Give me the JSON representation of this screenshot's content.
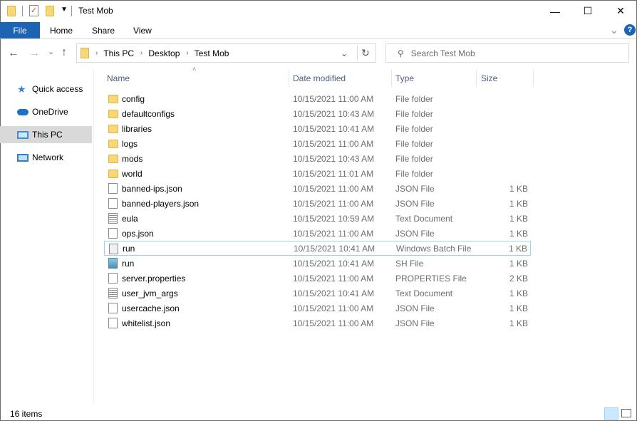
{
  "window": {
    "title": "Test Mob",
    "min": "—",
    "max": "☐",
    "close": "✕"
  },
  "ribbon": {
    "tabs": [
      "File",
      "Home",
      "Share",
      "View"
    ],
    "help": "?",
    "expand": "⌄"
  },
  "nav": {
    "back": "←",
    "forward": "→",
    "recent": "⌄",
    "up": "↑",
    "breadcrumb": [
      "This PC",
      "Desktop",
      "Test Mob"
    ],
    "dropdown": "⌄",
    "refresh": "↻",
    "search_placeholder": "Search Test Mob"
  },
  "sidebar": {
    "items": [
      {
        "label": "Quick access",
        "icon": "star-icon"
      },
      {
        "label": "OneDrive",
        "icon": "cloud-icon"
      },
      {
        "label": "This PC",
        "icon": "computer-icon",
        "selected": true
      },
      {
        "label": "Network",
        "icon": "network-icon"
      }
    ]
  },
  "columns": {
    "name": "Name",
    "date": "Date modified",
    "type": "Type",
    "size": "Size"
  },
  "files": [
    {
      "name": "config",
      "date": "10/15/2021 11:00 AM",
      "type": "File folder",
      "size": "",
      "icon": "folder"
    },
    {
      "name": "defaultconfigs",
      "date": "10/15/2021 10:43 AM",
      "type": "File folder",
      "size": "",
      "icon": "folder"
    },
    {
      "name": "libraries",
      "date": "10/15/2021 10:41 AM",
      "type": "File folder",
      "size": "",
      "icon": "folder"
    },
    {
      "name": "logs",
      "date": "10/15/2021 11:00 AM",
      "type": "File folder",
      "size": "",
      "icon": "folder"
    },
    {
      "name": "mods",
      "date": "10/15/2021 10:43 AM",
      "type": "File folder",
      "size": "",
      "icon": "folder"
    },
    {
      "name": "world",
      "date": "10/15/2021 11:01 AM",
      "type": "File folder",
      "size": "",
      "icon": "folder"
    },
    {
      "name": "banned-ips.json",
      "date": "10/15/2021 11:00 AM",
      "type": "JSON File",
      "size": "1 KB",
      "icon": "doc"
    },
    {
      "name": "banned-players.json",
      "date": "10/15/2021 11:00 AM",
      "type": "JSON File",
      "size": "1 KB",
      "icon": "doc"
    },
    {
      "name": "eula",
      "date": "10/15/2021 10:59 AM",
      "type": "Text Document",
      "size": "1 KB",
      "icon": "txt"
    },
    {
      "name": "ops.json",
      "date": "10/15/2021 11:00 AM",
      "type": "JSON File",
      "size": "1 KB",
      "icon": "doc"
    },
    {
      "name": "run",
      "date": "10/15/2021 10:41 AM",
      "type": "Windows Batch File",
      "size": "1 KB",
      "icon": "bat",
      "focused": true
    },
    {
      "name": "run",
      "date": "10/15/2021 10:41 AM",
      "type": "SH File",
      "size": "1 KB",
      "icon": "sh"
    },
    {
      "name": "server.properties",
      "date": "10/15/2021 11:00 AM",
      "type": "PROPERTIES File",
      "size": "2 KB",
      "icon": "doc"
    },
    {
      "name": "user_jvm_args",
      "date": "10/15/2021 10:41 AM",
      "type": "Text Document",
      "size": "1 KB",
      "icon": "txt"
    },
    {
      "name": "usercache.json",
      "date": "10/15/2021 11:00 AM",
      "type": "JSON File",
      "size": "1 KB",
      "icon": "doc"
    },
    {
      "name": "whitelist.json",
      "date": "10/15/2021 11:00 AM",
      "type": "JSON File",
      "size": "1 KB",
      "icon": "doc"
    }
  ],
  "status": {
    "count": "16 items"
  },
  "colors": {
    "accent": "#1e64b4",
    "selection": "#d9d9d9",
    "focus_border": "#99d1ff"
  }
}
